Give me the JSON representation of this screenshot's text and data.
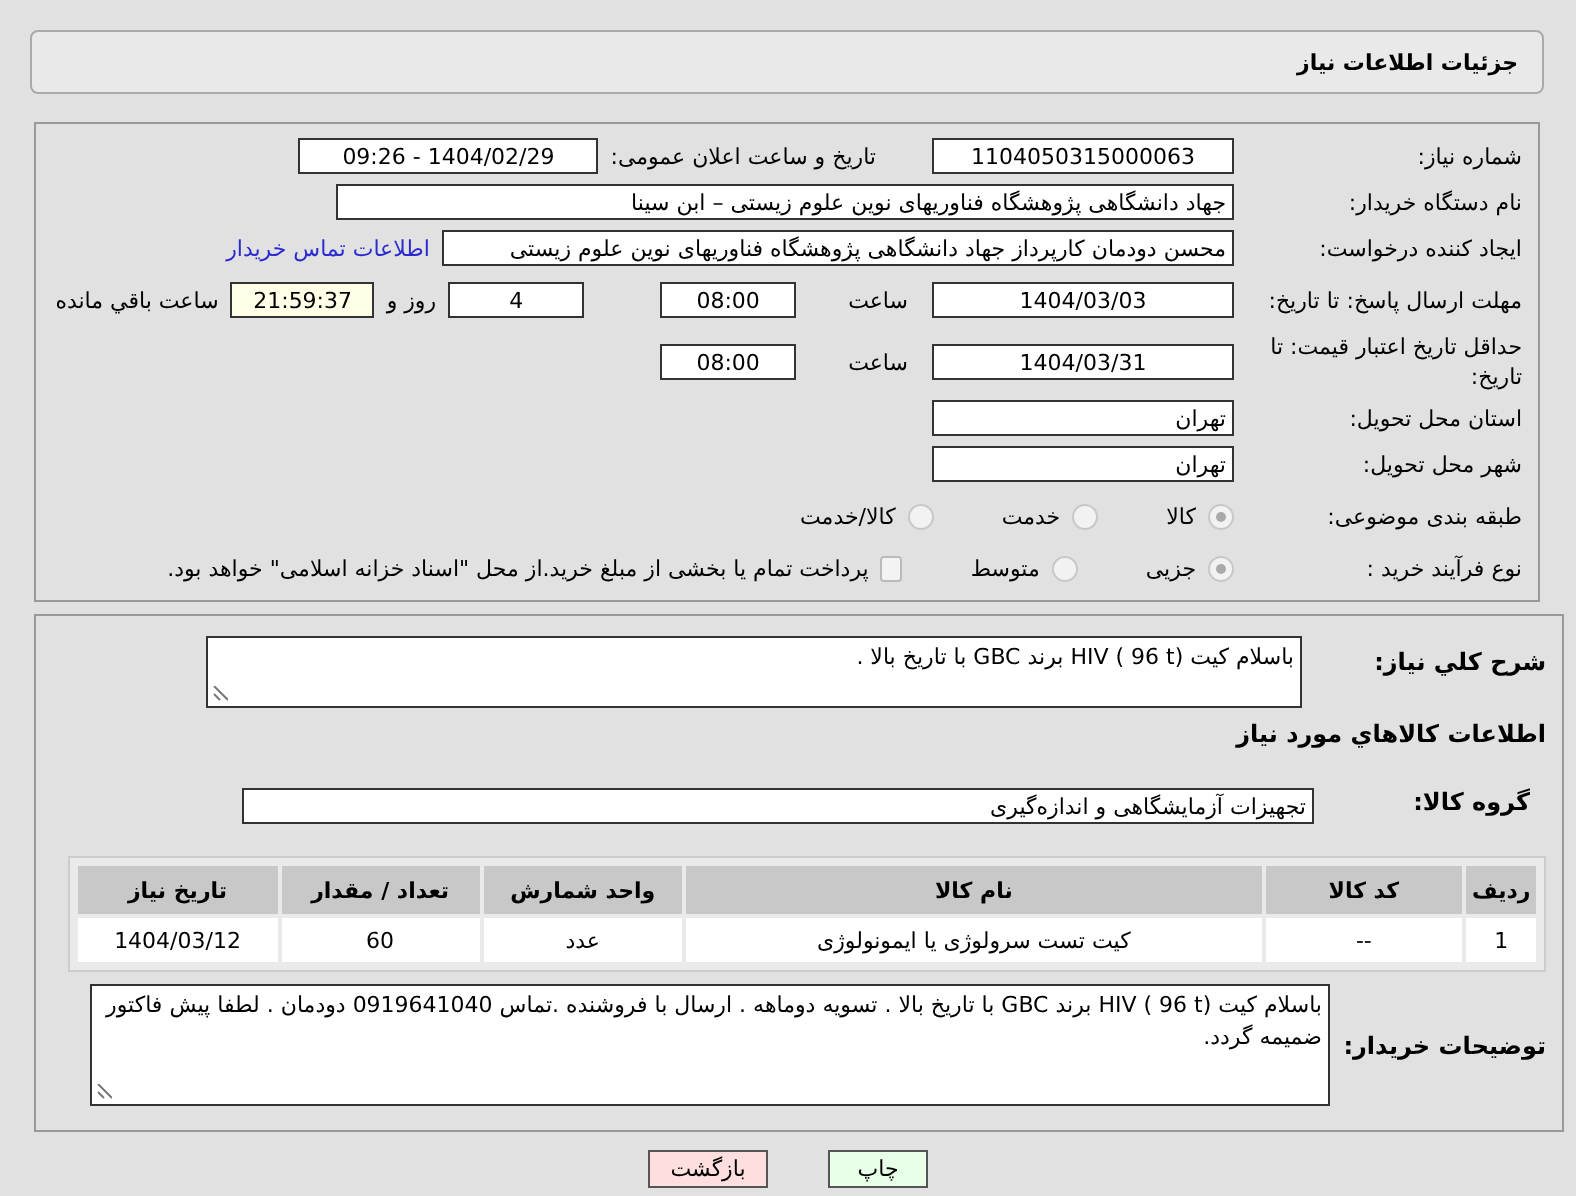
{
  "header": {
    "title": "جزئیات اطلاعات نیاز"
  },
  "fields": {
    "need_number": {
      "label": "شماره نیاز:",
      "value": "1104050315000063"
    },
    "announce": {
      "label": "تاریخ و ساعت اعلان عمومی:",
      "value": "1404/02/29 - 09:26"
    },
    "buyer": {
      "label": "نام دستگاه خریدار:",
      "value": "جهاد دانشگاهی پژوهشگاه فناوریهای نوین علوم زیستی – ابن سینا"
    },
    "creator": {
      "label": "ایجاد کننده درخواست:",
      "value": "محسن دودمان کارپرداز جهاد دانشگاهی پژوهشگاه فناوریهای نوین علوم زیستی",
      "link": "اطلاعات تماس خریدار"
    },
    "deadline": {
      "label": "مهلت ارسال پاسخ: تا تاریخ:",
      "date": "1404/03/03",
      "time_label": "ساعت",
      "time": "08:00",
      "days": "4",
      "days_label": "روز و",
      "remaining": "21:59:37",
      "remaining_label": "ساعت باقي مانده"
    },
    "validity": {
      "label": "حداقل تاریخ اعتبار قیمت: تا تاریخ:",
      "date": "1404/03/31",
      "time_label": "ساعت",
      "time": "08:00"
    },
    "province": {
      "label": "استان محل تحویل:",
      "value": "تهران"
    },
    "city": {
      "label": "شهر محل تحویل:",
      "value": "تهران"
    },
    "category": {
      "label": "طبقه بندی موضوعی:",
      "options": [
        {
          "label": "کالا",
          "selected": true
        },
        {
          "label": "خدمت",
          "selected": false
        },
        {
          "label": "کالا/خدمت",
          "selected": false
        }
      ]
    },
    "process": {
      "label": "نوع فرآیند خرید :",
      "options": [
        {
          "label": "جزیی",
          "selected": true
        },
        {
          "label": "متوسط",
          "selected": false
        }
      ],
      "payment": {
        "label": "پرداخت تمام یا بخشی از مبلغ خرید.از محل \"اسناد خزانه اسلامی\" خواهد بود.",
        "checked": false
      }
    }
  },
  "description": {
    "label": "شرح کلي نياز:",
    "value": "باسلام کیت HIV ( 96 t) برند GBC با  تاریخ بالا ."
  },
  "items": {
    "title": "اطلاعات کالاهاي مورد نياز",
    "group_label": "گروه کالا:",
    "group": "تجهیزات آزمایشگاهی و اندازه‌گیری",
    "table": {
      "columns": [
        "ردیف",
        "کد کالا",
        "نام کالا",
        "واحد شمارش",
        "تعداد / مقدار",
        "تاریخ نیاز"
      ],
      "rows": [
        [
          "1",
          "--",
          "کیت تست سرولوژی یا ایمونولوژی",
          "عدد",
          "60",
          "1404/03/12"
        ]
      ]
    }
  },
  "notes": {
    "label": "توضیحات خریدار:",
    "value": "باسلام کیت HIV ( 96 t) برند GBC با  تاریخ بالا . تسویه دوماهه . ارسال با فروشنده .تماس  0919641040 دودمان . لطفا پیش فاکتور ضمیمه گردد."
  },
  "buttons": [
    {
      "kind": "print",
      "label": "چاپ"
    },
    {
      "kind": "back",
      "label": "بازگشت"
    }
  ]
}
